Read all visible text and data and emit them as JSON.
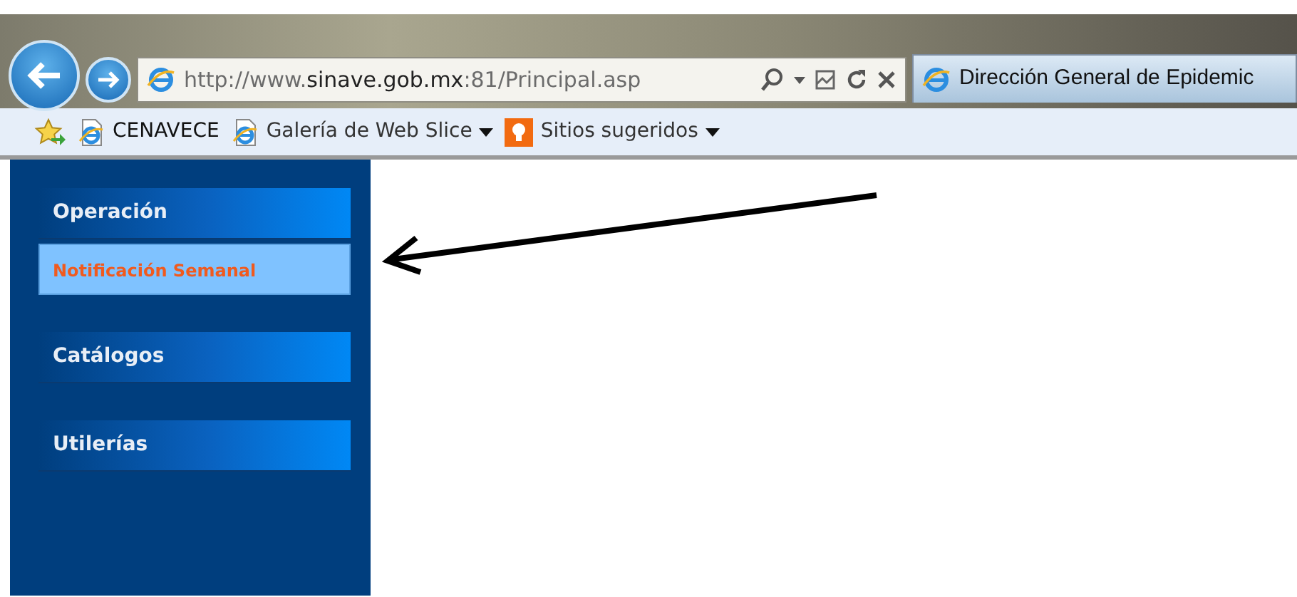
{
  "browser": {
    "address": "http://www.**sinave.gob.mx**:81/Principal.asp",
    "tab_title": "Dirección General de Epidemic"
  },
  "favorites_bar": [
    {
      "label": "CENAVECE",
      "kind": "page",
      "dropdown": false
    },
    {
      "label": "Galería de Web Slice",
      "kind": "page",
      "dropdown": true
    },
    {
      "label": "Sitios sugeridos",
      "kind": "suggest",
      "dropdown": true
    }
  ],
  "sidebar": {
    "sections": [
      {
        "label": "Operación",
        "items": [
          {
            "label": "Notificación Semanal"
          }
        ]
      },
      {
        "label": "Catálogos"
      },
      {
        "label": "Utilerías"
      }
    ]
  },
  "annotation": {
    "kind": "arrow"
  }
}
